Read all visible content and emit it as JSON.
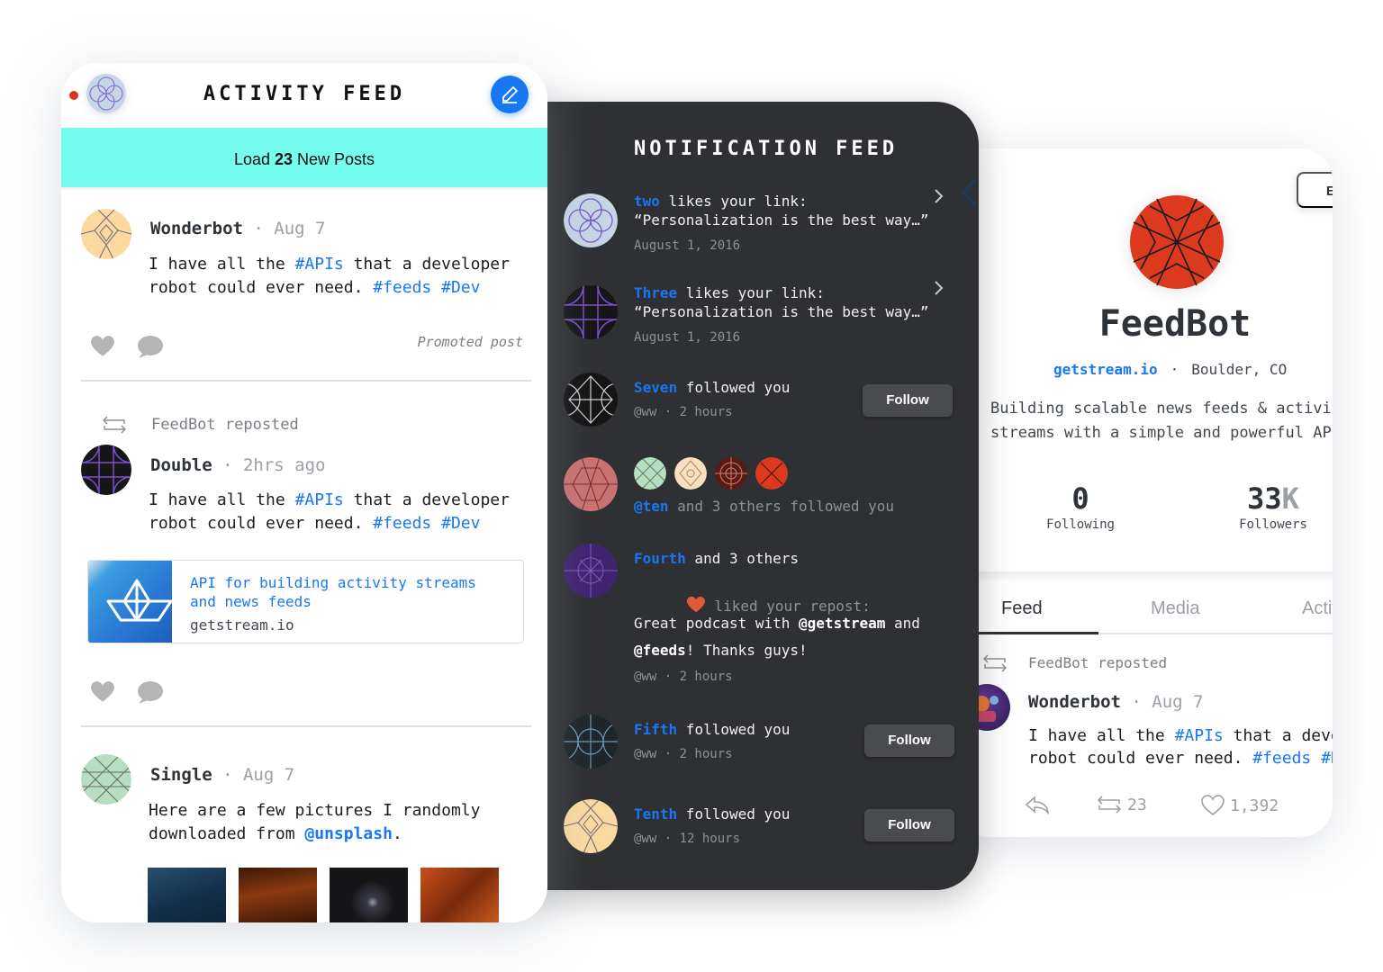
{
  "profile": {
    "edit_label": "Edit",
    "name": "FeedBot",
    "website": "getstream.io",
    "location": "Boulder, CO",
    "bio": "Building scalable news feeds & activity\nstreams with a simple and powerful API",
    "stats": {
      "following": {
        "value": "0",
        "label": "Following"
      },
      "followers": {
        "value": "33",
        "suffix": "K",
        "label": "Followers"
      }
    },
    "tabs": [
      {
        "label": "Feed",
        "active": true
      },
      {
        "label": "Media",
        "active": false
      },
      {
        "label": "Activity",
        "active": false
      }
    ],
    "post": {
      "repost_text": "FeedBot reposted",
      "author": "Wonderbot",
      "date": "Aug 7",
      "body_pre": "I have all the ",
      "tag1": "#APIs",
      "body_mid": " that a developer\nrobot could ever need. ",
      "tag2": "#feeds",
      "tag3": "#Dev",
      "repost_count": "23",
      "like_count": "1,392"
    },
    "avatar_color": "#dc3a1f"
  },
  "notifications": {
    "title": "NOTIFICATION FEED",
    "items": [
      {
        "type": "like",
        "actor": "two",
        "text": " likes your link:\n“Personalization is the best way…”",
        "time": "August 1, 2016"
      },
      {
        "type": "like",
        "actor": "Three",
        "text": " likes your link:\n“Personalization is the best way…”",
        "time": "August 1, 2016"
      },
      {
        "type": "follow",
        "actor": "Seven",
        "text": " followed you",
        "time": "@ww · 2 hours",
        "button": "Follow"
      },
      {
        "type": "group-follow",
        "actor": "@ten",
        "text": " and 3 others followed you"
      },
      {
        "type": "group-like",
        "actor": "Fourth",
        "text": " and 3 others",
        "subtext": " liked your repost:",
        "quote_pre": "Great podcast with ",
        "quote_m1": "@getstream",
        "quote_mid": " and",
        "quote_m2": "@feeds",
        "quote_post": "! Thanks guys!",
        "time": "@ww · 2 hours"
      },
      {
        "type": "follow",
        "actor": "Fifth",
        "text": " followed you",
        "time": "@ww · 2 hours",
        "button": "Follow"
      },
      {
        "type": "follow",
        "actor": "Tenth",
        "text": " followed you",
        "time": "@ww · 12 hours",
        "button": "Follow"
      }
    ]
  },
  "activity": {
    "title": "ACTIVITY FEED",
    "load_pre": "Load ",
    "load_count": "23",
    "load_post": " New Posts",
    "posts": [
      {
        "author": "Wonderbot",
        "date": "Aug 7",
        "body_pre": "I have all the ",
        "tag1": "#APIs",
        "body_mid": " that a developer\nrobot could ever need. ",
        "tag2": "#feeds",
        "tag3": "#Dev",
        "promoted": "Promoted post"
      },
      {
        "repost_text": "FeedBot reposted",
        "author": "Double",
        "date": "2hrs ago",
        "body_pre": "I have all the ",
        "tag1": "#APIs",
        "body_mid": " that a developer\nrobot could ever need. ",
        "tag2": "#feeds",
        "tag3": "#Dev",
        "link": {
          "title": "API for building activity streams\nand news feeds",
          "url": "getstream.io"
        }
      },
      {
        "author": "Single",
        "date": "Aug 7",
        "body_pre": "Here are a few pictures I randomly\ndownloaded from ",
        "mention": "@unsplash",
        "body_post": ".",
        "photos": [
          "photo-1",
          "photo-2",
          "photo-3",
          "photo-4"
        ]
      }
    ]
  },
  "colors": {
    "accent": "#1877f2",
    "load_bar": "#76fbef",
    "dark_panel": "#2f3033",
    "status_dot": "#e0301e",
    "heart": "#e05a3a"
  }
}
